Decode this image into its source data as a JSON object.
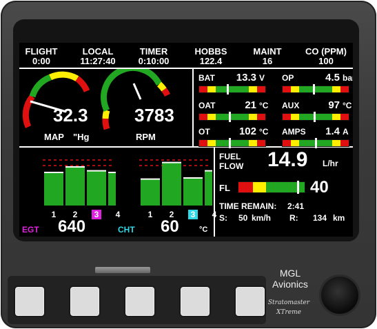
{
  "header": {
    "flight": {
      "label": "FLIGHT",
      "value": "0:00"
    },
    "local": {
      "label": "LOCAL",
      "value": "11:27:40"
    },
    "timer": {
      "label": "TIMER",
      "value": "0:10:00"
    },
    "hobbs": {
      "label": "HOBBS",
      "value": "122.4"
    },
    "maint": {
      "label": "MAINT",
      "value": "16"
    },
    "co": {
      "label": "CO (PPM)",
      "value": "100"
    }
  },
  "map_gauge": {
    "value": "32.3",
    "label": "MAP",
    "unit": "\"Hg"
  },
  "rpm_gauge": {
    "value": "3783",
    "label": "RPM"
  },
  "bat": {
    "label": "BAT",
    "value": "13.3",
    "unit": "V",
    "level": 0.43
  },
  "op": {
    "label": "OP",
    "value": "4.5",
    "unit": "bar",
    "level": 0.47
  },
  "oat": {
    "label": "OAT",
    "value": "21",
    "unit": "°C",
    "level": 0.46
  },
  "aux": {
    "label": "AUX",
    "value": "97",
    "unit": "°C",
    "level": 0.48
  },
  "ot": {
    "label": "OT",
    "value": "102",
    "unit": "°C",
    "level": 0.46
  },
  "amps": {
    "label": "AMPS",
    "value": "1.4",
    "unit": "A",
    "level": 0.5
  },
  "egt": {
    "label": "EGT",
    "value": "640",
    "tabs": [
      "1",
      "2",
      "3",
      "4"
    ],
    "selected": 3,
    "levels": [
      0.6,
      0.7,
      0.63,
      0.6
    ]
  },
  "cht": {
    "label": "CHT",
    "value": "60",
    "unit": "°C",
    "tabs": [
      "1",
      "2",
      "3",
      "4"
    ],
    "selected": 3,
    "levels": [
      0.48,
      0.78,
      0.5,
      0.63
    ]
  },
  "fuel": {
    "flow_label_1": "FUEL",
    "flow_label_2": "FLOW",
    "flow_value": "14.9",
    "flow_unit": "L/hr",
    "level_label": "FL",
    "level_value": "40",
    "level": 0.9,
    "time_remain_label": "TIME REMAIN:",
    "time_remain_value": "2:41",
    "speed_label": "S:",
    "speed_value": "50",
    "speed_unit": "km/h",
    "range_label": "R:",
    "range_value": "134",
    "range_unit": "km"
  },
  "brand": {
    "line1": "MGL",
    "line2": "Avionics",
    "model1": "Stratomaster",
    "model2": "XTreme"
  },
  "colors": {
    "green": "#22a722",
    "yellow": "#ffee00",
    "red": "#e01010",
    "egt_tab": "#e020e0",
    "cht_tab": "#30d8e8"
  }
}
